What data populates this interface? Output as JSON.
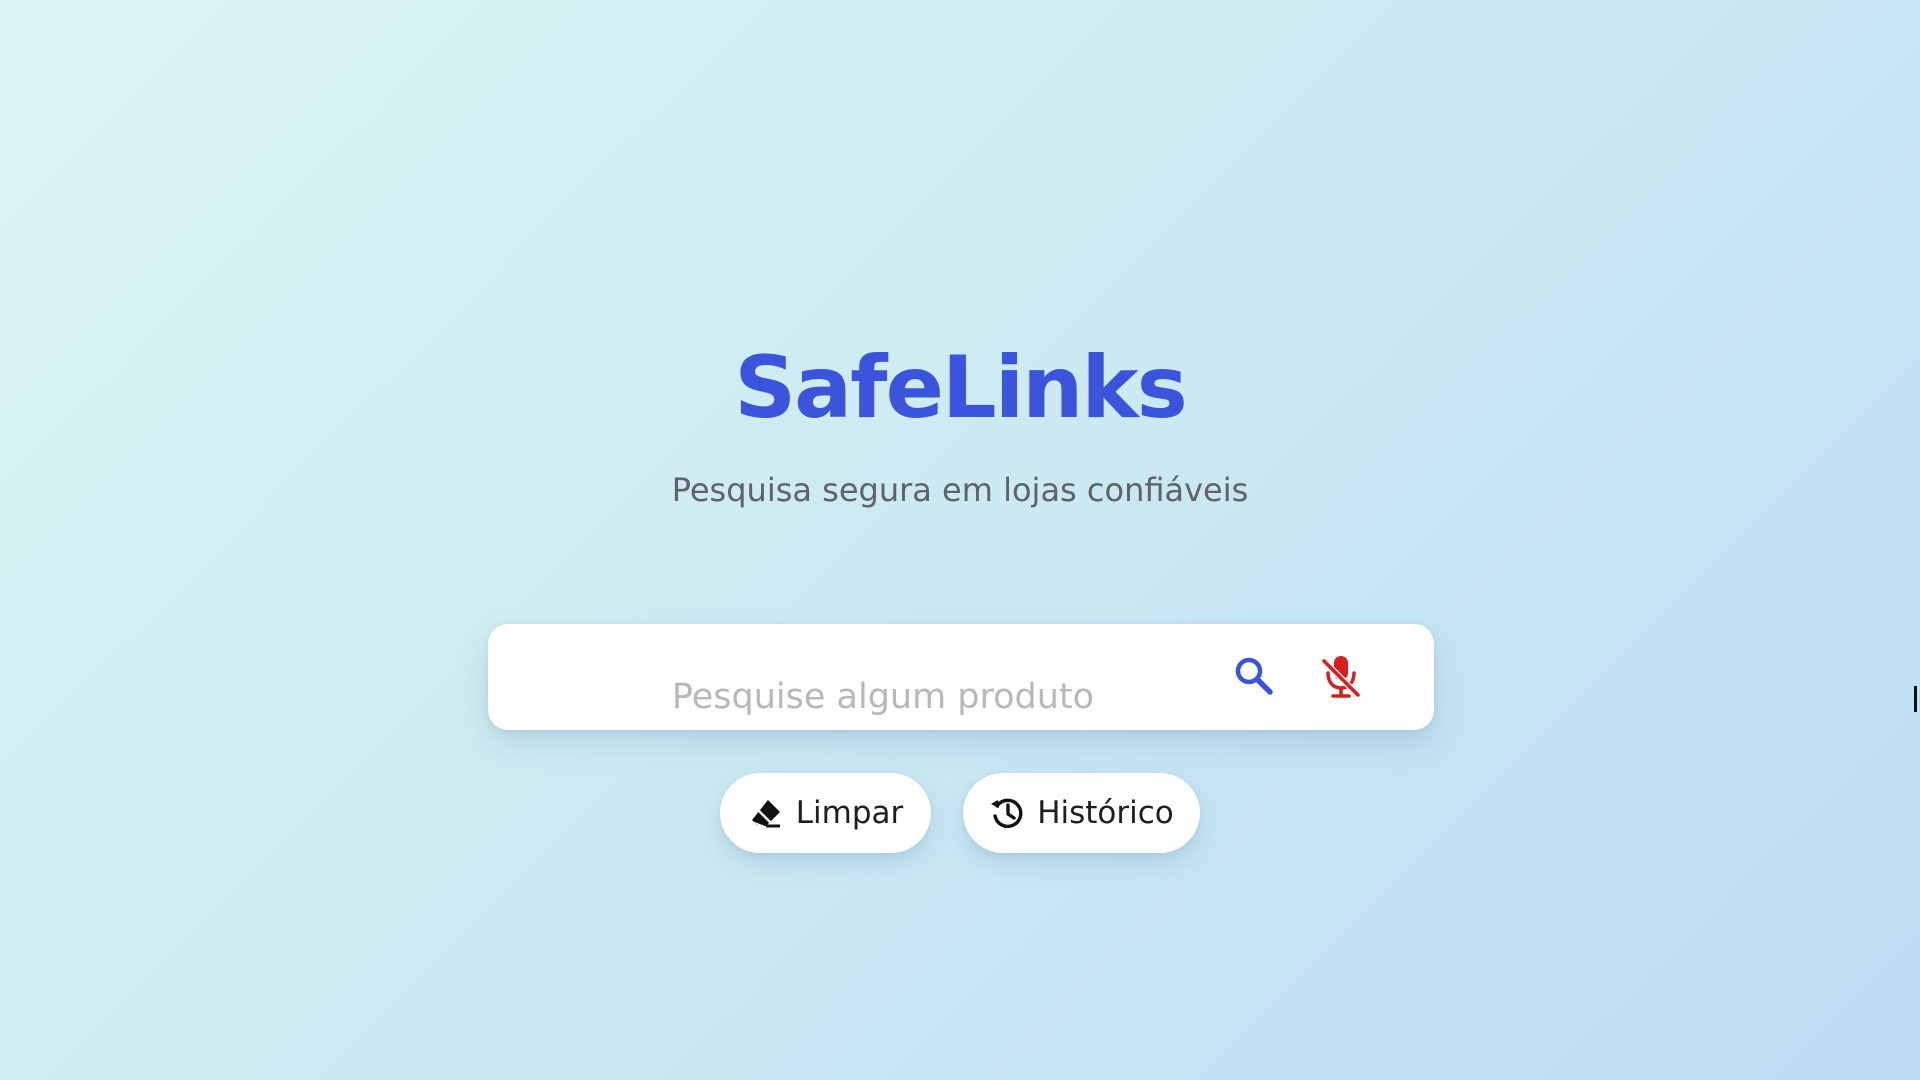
{
  "app": {
    "title": "SafeLinks",
    "subtitle": "Pesquisa segura em lojas confiáveis"
  },
  "search": {
    "value": "",
    "placeholder": "Pesquise algum produto",
    "search_icon": "search-icon",
    "mic_icon": "mic-off-icon"
  },
  "actions": {
    "clear_label": "Limpar",
    "clear_icon": "eraser-icon",
    "history_label": "Histórico",
    "history_icon": "history-icon"
  },
  "colors": {
    "brand": "#3a55dc",
    "subtitle": "#5f6367",
    "mic_off": "#d81e1e",
    "background_start": "#dcf5f5",
    "background_end": "#bcdcf4"
  }
}
